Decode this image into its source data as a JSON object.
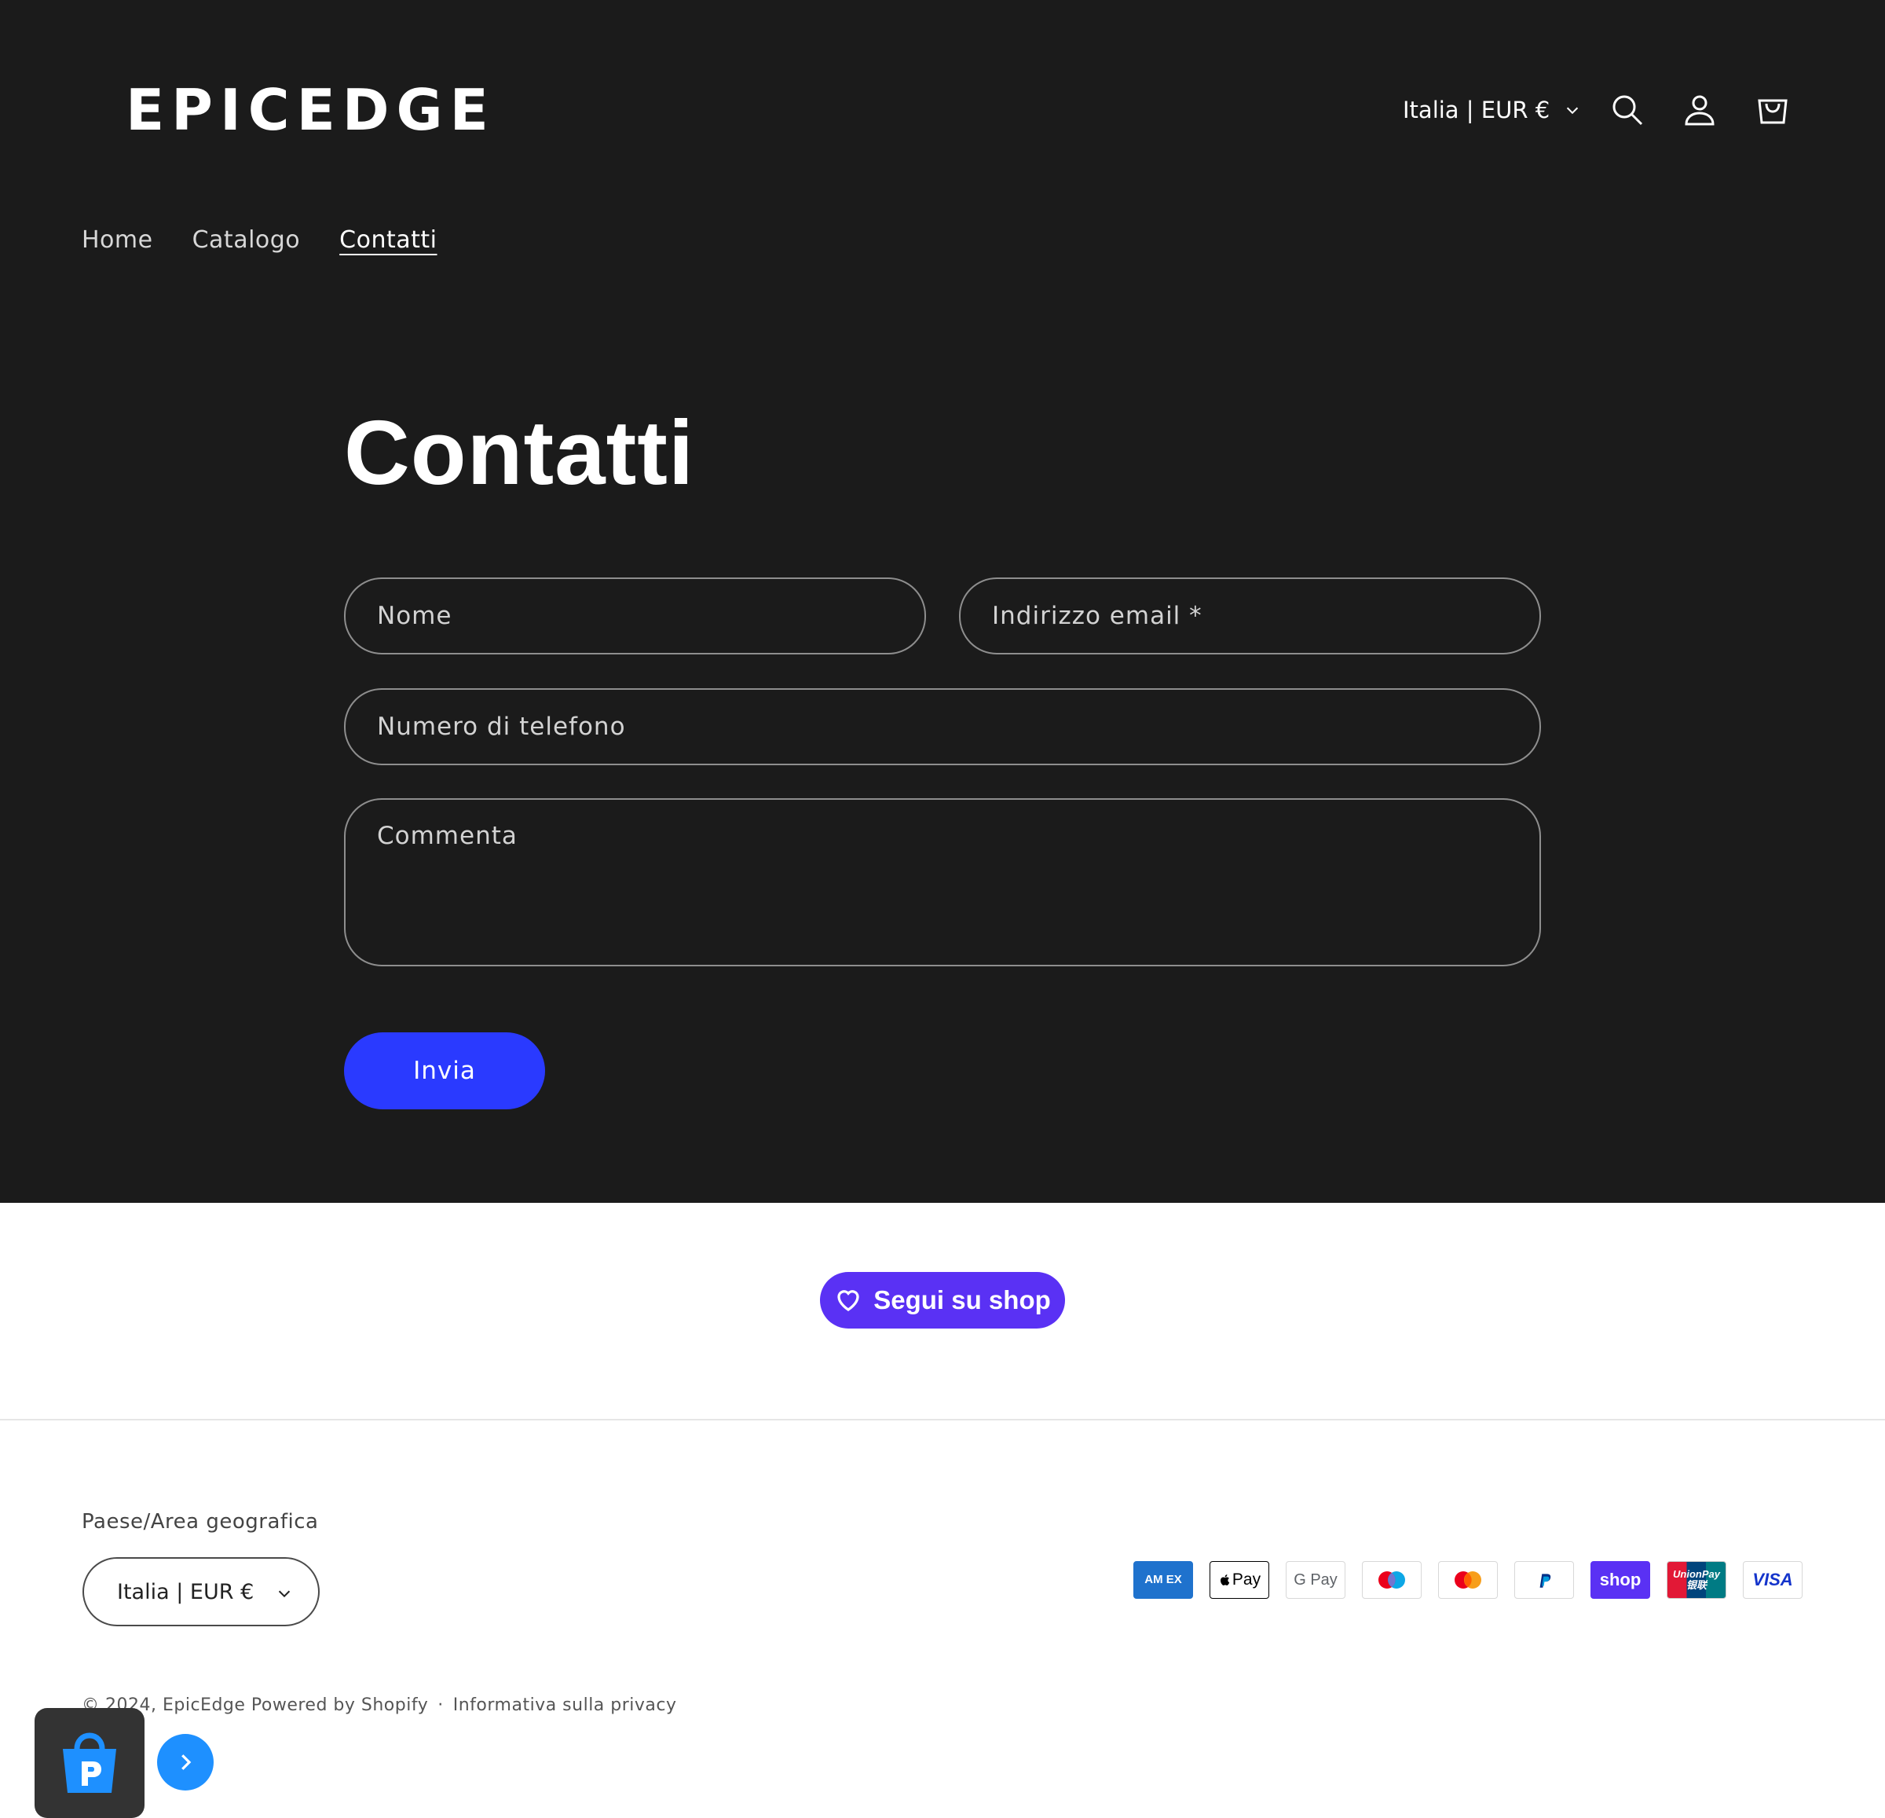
{
  "header": {
    "logo_text": "EPICEDGE",
    "locale": "Italia | EUR €",
    "icons": [
      "search-icon",
      "account-icon",
      "cart-icon"
    ]
  },
  "nav": {
    "items": [
      {
        "label": "Home"
      },
      {
        "label": "Catalogo"
      },
      {
        "label": "Contatti",
        "active": true
      }
    ]
  },
  "main": {
    "title": "Contatti",
    "form": {
      "name_placeholder": "Nome",
      "email_placeholder": "Indirizzo email *",
      "phone_placeholder": "Numero di telefono",
      "comment_placeholder": "Commenta",
      "submit_label": "Invia"
    }
  },
  "footer": {
    "follow_label": "Segui su shop",
    "region_label": "Paese/Area geografica",
    "region_value": "Italia | EUR €",
    "payments": {
      "amex": "AM EX",
      "apple": "Pay",
      "gpay": "G Pay",
      "shop": "shop",
      "union": "UnionPay 银联",
      "visa": "VISA"
    },
    "copyright": "© 2024, EpicEdge Powered by Shopify",
    "separator": "·",
    "privacy_link": "Informativa sulla privacy"
  },
  "colors": {
    "dark_bg": "#1b1b1b",
    "accent_button": "#2a3aff",
    "shop_purple": "#5a31f4"
  }
}
